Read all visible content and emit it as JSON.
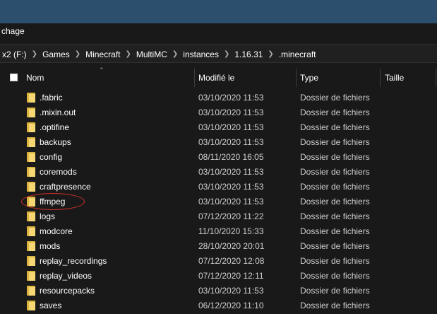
{
  "window": {
    "ribbon_tab": "chage"
  },
  "address": {
    "crumbs": [
      "x2 (F:)",
      "Games",
      "Minecraft",
      "MultiMC",
      "instances",
      "1.16.31",
      ".minecraft"
    ]
  },
  "columns": {
    "name": "Nom",
    "modified": "Modifié le",
    "type": "Type",
    "size": "Taille"
  },
  "files": [
    {
      "name": ".fabric",
      "modified": "03/10/2020 11:53",
      "type": "Dossier de fichiers"
    },
    {
      "name": ".mixin.out",
      "modified": "03/10/2020 11:53",
      "type": "Dossier de fichiers"
    },
    {
      "name": ".optifine",
      "modified": "03/10/2020 11:53",
      "type": "Dossier de fichiers"
    },
    {
      "name": "backups",
      "modified": "03/10/2020 11:53",
      "type": "Dossier de fichiers"
    },
    {
      "name": "config",
      "modified": "08/11/2020 16:05",
      "type": "Dossier de fichiers"
    },
    {
      "name": "coremods",
      "modified": "03/10/2020 11:53",
      "type": "Dossier de fichiers"
    },
    {
      "name": "craftpresence",
      "modified": "03/10/2020 11:53",
      "type": "Dossier de fichiers"
    },
    {
      "name": "ffmpeg",
      "modified": "03/10/2020 11:53",
      "type": "Dossier de fichiers"
    },
    {
      "name": "logs",
      "modified": "07/12/2020 11:22",
      "type": "Dossier de fichiers"
    },
    {
      "name": "modcore",
      "modified": "11/10/2020 15:33",
      "type": "Dossier de fichiers"
    },
    {
      "name": "mods",
      "modified": "28/10/2020 20:01",
      "type": "Dossier de fichiers"
    },
    {
      "name": "replay_recordings",
      "modified": "07/12/2020 12:08",
      "type": "Dossier de fichiers"
    },
    {
      "name": "replay_videos",
      "modified": "07/12/2020 12:11",
      "type": "Dossier de fichiers"
    },
    {
      "name": "resourcepacks",
      "modified": "03/10/2020 11:53",
      "type": "Dossier de fichiers"
    },
    {
      "name": "saves",
      "modified": "06/12/2020 11:10",
      "type": "Dossier de fichiers"
    }
  ],
  "icons": {
    "folder": "folder-icon",
    "breadcrumb_separator": "chevron-right-icon",
    "sort": "sort-ascending-icon"
  },
  "colors": {
    "folder": "#f7d774",
    "annotation": "#d0302a",
    "titlebar": "#2b4f6c"
  }
}
